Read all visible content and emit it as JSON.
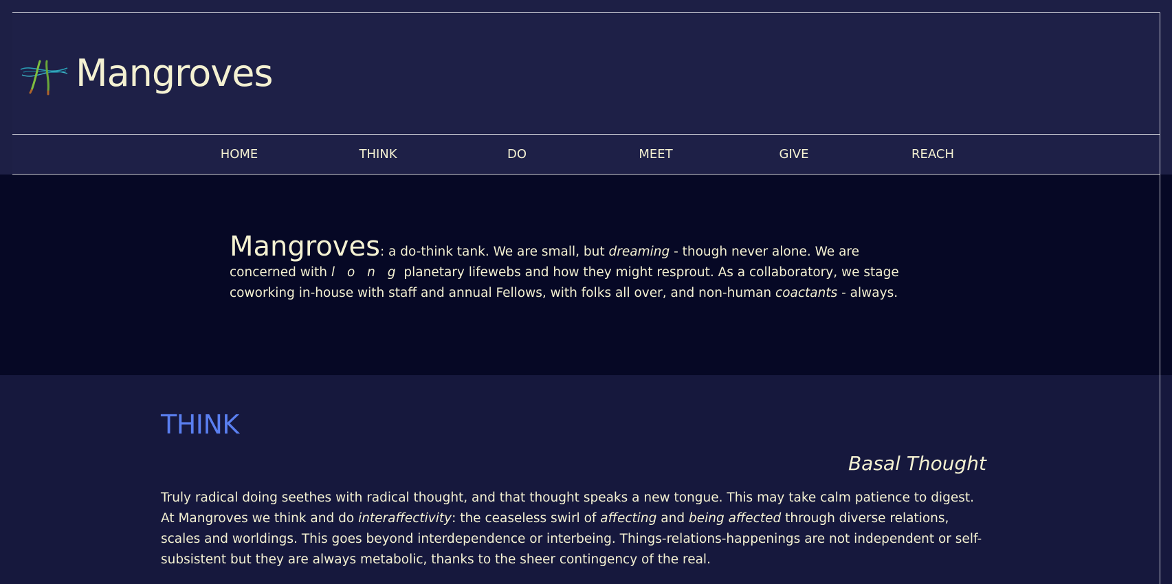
{
  "header": {
    "site_title": "Mangroves",
    "logo_icon": "mangrove-roots-icon"
  },
  "nav": {
    "items": [
      {
        "label": "HOME"
      },
      {
        "label": "THINK"
      },
      {
        "label": "DO"
      },
      {
        "label": "MEET"
      },
      {
        "label": "GIVE"
      },
      {
        "label": "REACH"
      }
    ]
  },
  "intro": {
    "lead": "Mangroves",
    "t1": ": a do-think tank. We are small, but ",
    "em1": "dreaming",
    "t2": " - though never alone. We are concerned with ",
    "em2": "l o n g",
    "t3": " planetary lifewebs and how they might resprout. As a collaboratory, we stage coworking in-house with staff and annual Fellows, with folks all over, and non-human ",
    "em3": "coactants",
    "t4": " - always."
  },
  "think": {
    "heading": "THINK",
    "subheading": "Basal Thought",
    "t1": "Truly radical doing seethes with radical thought, and that thought speaks a new tongue. This may take calm patience to digest. At Mangroves we think and do ",
    "em1": "interaffectivity",
    "t2": ": the ceaseless swirl of ",
    "em2": "affecting",
    "t3": " and ",
    "em3": "being affected",
    "t4": " through diverse relations, scales and worldings. This goes beyond interdependence or interbeing. Things-relations-happenings are not independent or self-subsistent but they are always metabolic, thanks to the sheer contingency of the real."
  },
  "colors": {
    "background": "#1d1f45",
    "intro_band": "#060825",
    "think_band": "#16183d",
    "text": "#f4f1d2",
    "accent": "#5a7ff0"
  }
}
